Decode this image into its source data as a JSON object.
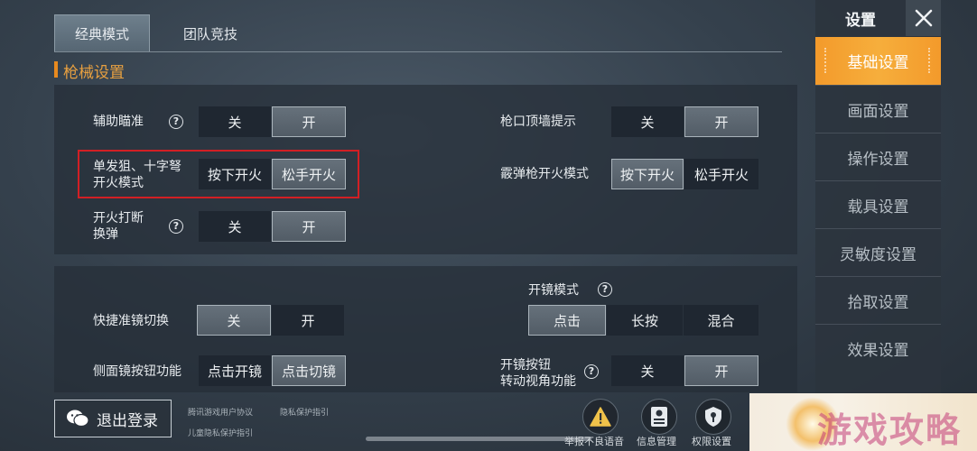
{
  "tabs": [
    {
      "label": "经典模式",
      "active": true
    },
    {
      "label": "团队竞技",
      "active": false
    }
  ],
  "section_title": "枪械设置",
  "settings": {
    "aim_assist": {
      "label": "辅助瞄准",
      "options": [
        "关",
        "开"
      ],
      "selected": "开"
    },
    "muzzle_hint": {
      "label": "枪口顶墙提示",
      "options": [
        "关",
        "开"
      ],
      "selected": "开"
    },
    "sniper_fire": {
      "label_line1": "单发狙、十字弩",
      "label_line2": "开火模式",
      "options": [
        "按下开火",
        "松手开火"
      ],
      "selected": "松手开火"
    },
    "shotgun_fire": {
      "label": "霰弹枪开火模式",
      "options": [
        "按下开火",
        "松手开火"
      ],
      "selected": "按下开火"
    },
    "fire_interrupt": {
      "label_line1": "开火打断",
      "label_line2": "换弹",
      "options": [
        "关",
        "开"
      ],
      "selected": "开"
    },
    "scope_mode": {
      "label": "开镜模式",
      "options": [
        "点击",
        "长按",
        "混合"
      ],
      "selected": "点击"
    },
    "quick_scope": {
      "label": "快捷准镜切换",
      "options": [
        "关",
        "开"
      ],
      "selected": "关"
    },
    "side_scope": {
      "label": "侧面镜按钮功能",
      "options": [
        "点击开镜",
        "点击切镜"
      ],
      "selected": "点击切镜"
    },
    "scope_rotate": {
      "label_line1": "开镜按钮",
      "label_line2": "转动视角功能",
      "options": [
        "关",
        "开"
      ],
      "selected": "开"
    }
  },
  "sidebar": {
    "title": "设置",
    "items": [
      {
        "label": "基础设置",
        "active": true
      },
      {
        "label": "画面设置",
        "active": false
      },
      {
        "label": "操作设置",
        "active": false
      },
      {
        "label": "载具设置",
        "active": false
      },
      {
        "label": "灵敏度设置",
        "active": false
      },
      {
        "label": "拾取设置",
        "active": false
      },
      {
        "label": "效果设置",
        "active": false
      }
    ]
  },
  "bottom": {
    "logout_label": "退出登录",
    "links": [
      "腾讯游戏用户协议",
      "隐私保护指引",
      "儿童隐私保护指引"
    ],
    "icon_labels": [
      "举报不良语音",
      "信息管理",
      "权限设置"
    ]
  },
  "watermark": "游戏攻略",
  "colors": {
    "accent": "#f39a2b",
    "highlight_box": "#d21f24",
    "section_title": "#e8a040"
  }
}
